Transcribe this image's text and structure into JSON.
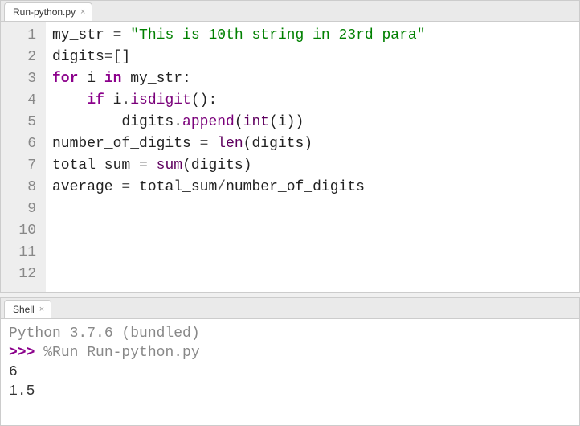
{
  "editor_tab": {
    "label": "Run-python.py",
    "close": "×"
  },
  "shell_tab": {
    "label": "Shell",
    "close": "×"
  },
  "gutter": [
    "1",
    "2",
    "3",
    "4",
    "5",
    "6",
    "7",
    "8",
    "9",
    "10",
    "11",
    "12"
  ],
  "code": {
    "l1": {
      "a": "my_str ",
      "eq": "=",
      "b": " ",
      "s": "\"This is 10th string in 23rd para\""
    },
    "l2": "",
    "l3": {
      "a": "digits",
      "eq": "=",
      "b": "[]"
    },
    "l4": "",
    "l5": {
      "kfor": "for",
      "a": " i ",
      "kin": "in",
      "b": " my_str:"
    },
    "l6": {
      "pad": "    ",
      "kif": "if",
      "a": " i",
      "dot": ".",
      "fn": "isdigit",
      "b": "():"
    },
    "l7": {
      "pad": "        ",
      "a": "digits",
      "dot": ".",
      "fn": "append",
      "op": "(",
      "bi": "int",
      "c": "(i))"
    },
    "l8": "",
    "l9": {
      "a": "number_of_digits ",
      "eq": "=",
      "b": " ",
      "bi": "len",
      "c": "(digits)"
    },
    "l10": {
      "a": "total_sum ",
      "eq": "=",
      "b": " ",
      "bi": "sum",
      "c": "(digits)"
    },
    "l11": {
      "a": "average ",
      "eq": "=",
      "b": " total_sum",
      "op": "/",
      "c": "number_of_digits"
    },
    "l12": ""
  },
  "shell": {
    "version": "Python 3.7.6 (bundled)",
    "prompt": ">>> ",
    "cmd": "%Run Run-python.py",
    "out1": " 6",
    "out2": " 1.5"
  }
}
